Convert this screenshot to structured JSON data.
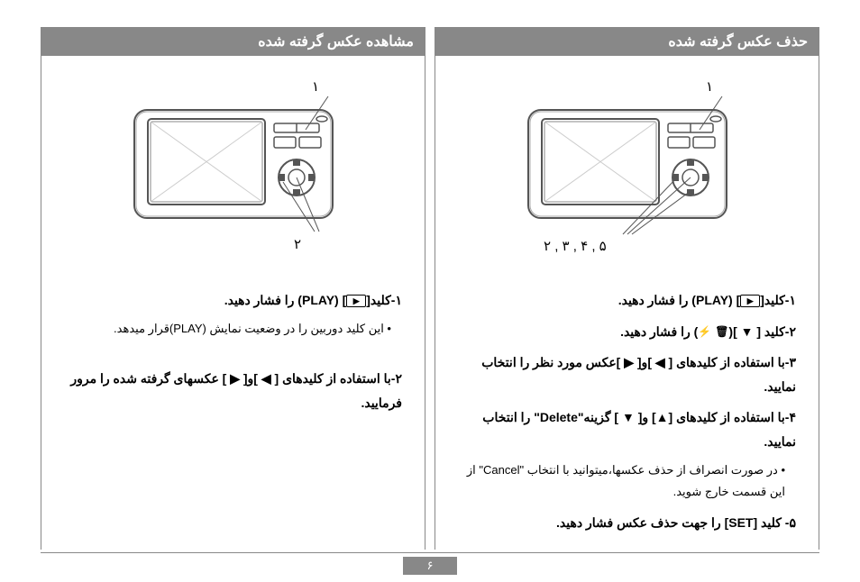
{
  "page_number": "۶",
  "right_panel": {
    "title": "مشاهده عکس گرفته شده",
    "callouts": {
      "c1": "۱",
      "c2": "۲"
    },
    "step1": "۱-کلید[",
    "step1_after": "] (PLAY) را فشار دهید.",
    "note1": "• این کلید دوربین را در وضعیت نمایش (PLAY)قرار میدهد.",
    "step2": "۲-با استفاده از کلیدهای [ ◀ ]و[ ▶ ] عکسهای گرفته شده را مرور فرمایید."
  },
  "left_panel": {
    "title": "حذف عکس گرفته شده",
    "callouts": {
      "c1": "۱",
      "c2": "۲ , ۳ , ۴ , ۵"
    },
    "step1": "۱-کلید[",
    "step1_after": "] (PLAY) را فشار دهید.",
    "step2_pre": "۲-کلید [ ▼ ](",
    "step2_post": ") را فشار دهید.",
    "step3": "۳-با استفاده از کلیدهای [ ◀ ]و[ ▶ ]عکس مورد نظر  را انتخاب نمایید.",
    "step4": "۴-با استفاده از کلیدهای [▲] و[ ▼ ] گزینه\"Delete\" را انتخاب نمایید.",
    "note4": "• در صورت انصراف از حذف عکسها،میتوانید با انتخاب \"Cancel\" از این قسمت خارج شوید.",
    "step5": "۵- کلید  [SET] را جهت حذف عکس فشار دهید."
  }
}
